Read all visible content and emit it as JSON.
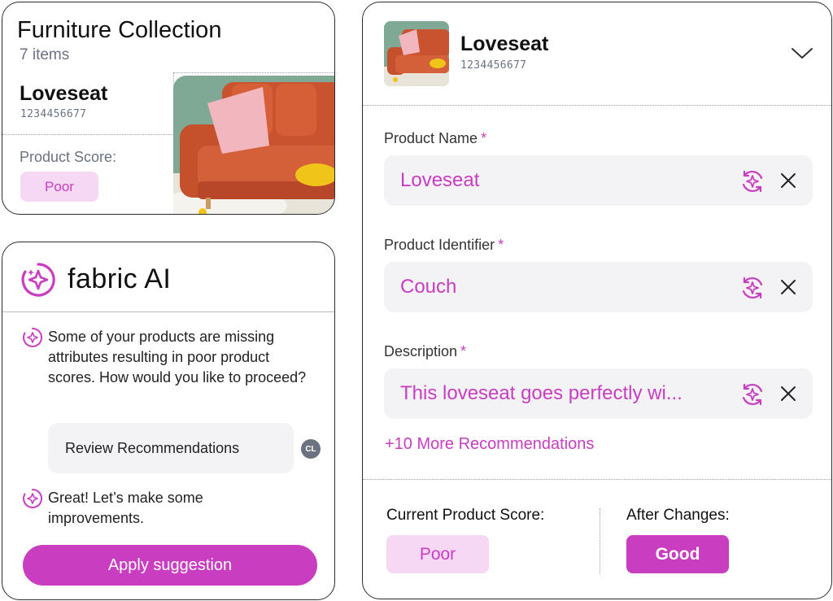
{
  "collection": {
    "title": "Furniture Collection",
    "count": "7 items",
    "product_name": "Loveseat",
    "product_id": "1234456677",
    "score_label": "Product Score:",
    "score_value": "Poor"
  },
  "ai_panel": {
    "title": "fabric AI",
    "messages": [
      "Some of your products are missing attributes resulting in poor product scores. How would you like to proceed?",
      "Great! Let’s make some improvements."
    ],
    "user_reply": "Review Recommendations",
    "user_initials": "CL",
    "apply_button": "Apply suggestion"
  },
  "editor": {
    "product_name": "Loveseat",
    "product_id": "1234456677",
    "fields": [
      {
        "label": "Product Name",
        "required_mark": "*",
        "value": "Loveseat"
      },
      {
        "label": "Product Identifier",
        "required_mark": "*",
        "value": "Couch"
      },
      {
        "label": "Description",
        "required_mark": "*",
        "value": "This loveseat goes perfectly wi..."
      }
    ],
    "more_link": "+10 More Recommendations",
    "current_score_label": "Current Product Score:",
    "current_score": "Poor",
    "after_label": "After Changes:",
    "after_score": "Good"
  },
  "icons": {
    "ai": "sparkle-refresh-icon",
    "clear": "close-icon",
    "expand": "chevron-down-icon"
  },
  "colors": {
    "accent": "#c93dc1",
    "accent_light": "#f7d8f4",
    "field_bg": "#f3f3f6",
    "muted_text": "#6b7280"
  }
}
